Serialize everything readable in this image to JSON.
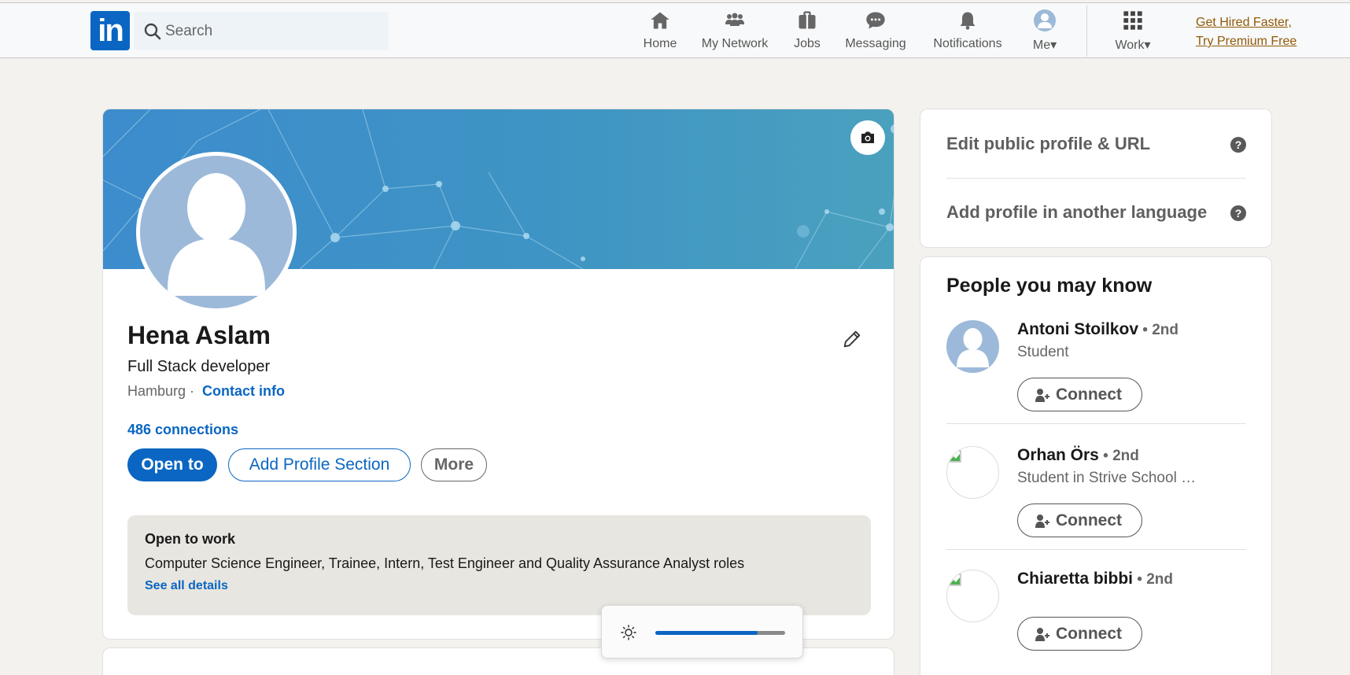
{
  "nav": {
    "logo": "in",
    "search_placeholder": "Search",
    "items": [
      {
        "label": "Home",
        "icon": "home-icon"
      },
      {
        "label": "My Network",
        "icon": "network-icon"
      },
      {
        "label": "Jobs",
        "icon": "briefcase-icon"
      },
      {
        "label": "Messaging",
        "icon": "chat-icon"
      },
      {
        "label": "Notifications",
        "icon": "bell-icon"
      },
      {
        "label": "Me▾",
        "icon": "avatar-icon"
      },
      {
        "label": "Work▾",
        "icon": "grid-icon"
      }
    ],
    "premium_line1": "Get Hired Faster,",
    "premium_line2": "Try Premium Free"
  },
  "profile": {
    "name": "Hena Aslam",
    "headline": "Full Stack developer",
    "location": "Hamburg · ",
    "contact": "Contact info",
    "connections": "486 connections",
    "buttons": {
      "open_to": "Open to",
      "add_section": "Add Profile Section",
      "more": "More"
    },
    "open_to_work": {
      "title": "Open to work",
      "roles": "Computer Science Engineer, Trainee, Intern, Test Engineer and Quality Assurance Analyst roles",
      "link": "See all details"
    }
  },
  "side": {
    "edit_public": "Edit public profile & URL",
    "add_language": "Add profile in another language",
    "pymk_title": "People you may know",
    "people": [
      {
        "name": "Antoni Stoilkov",
        "degree": " • 2nd",
        "headline": "Student",
        "connect": "Connect"
      },
      {
        "name": "Orhan Örs",
        "degree": " • 2nd",
        "headline": "Student in Strive School …",
        "connect": "Connect"
      },
      {
        "name": "Chiaretta bibbi",
        "degree": " • 2nd",
        "headline": "",
        "connect": "Connect"
      }
    ]
  },
  "brightness": {
    "level": 0.79
  },
  "colors": {
    "brand": "#0a66c2",
    "premium": "#915907",
    "background": "#f3f2ef"
  }
}
